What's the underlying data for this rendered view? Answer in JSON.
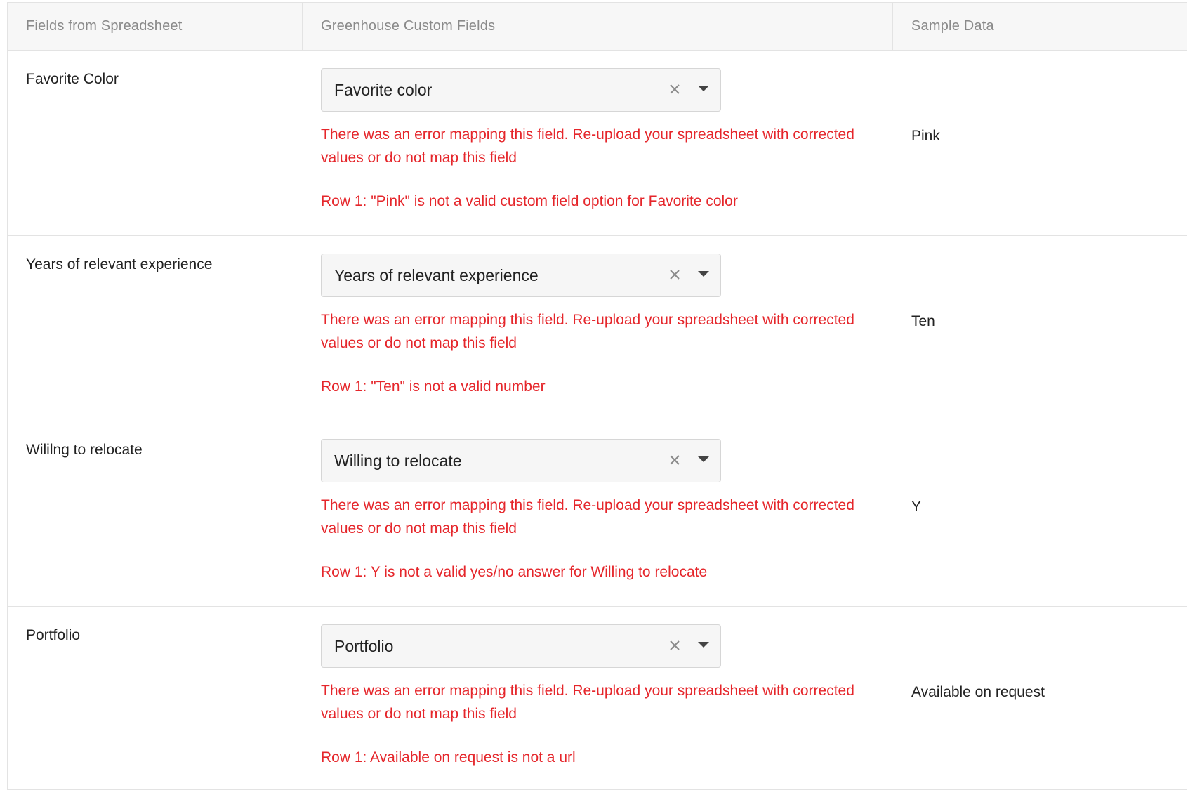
{
  "header": {
    "col_spreadsheet": "Fields from Spreadsheet",
    "col_custom": "Greenhouse Custom Fields",
    "col_sample": "Sample Data"
  },
  "rows": [
    {
      "spreadsheet_field": "Favorite Color",
      "selected_custom_field": "Favorite color",
      "error_main": "There was an error mapping this field. Re-upload your spreadsheet with corrected values or do not map this field",
      "error_detail": "Row 1: \"Pink\" is not a valid custom field option for Favorite color",
      "sample": "Pink"
    },
    {
      "spreadsheet_field": "Years of relevant experience",
      "selected_custom_field": "Years of relevant experience",
      "error_main": "There was an error mapping this field. Re-upload your spreadsheet with corrected values or do not map this field",
      "error_detail": "Row 1: \"Ten\" is not a valid number",
      "sample": "Ten"
    },
    {
      "spreadsheet_field": "Wililng to relocate",
      "selected_custom_field": "Willing to relocate",
      "error_main": "There was an error mapping this field. Re-upload your spreadsheet with corrected values or do not map this field",
      "error_detail": "Row 1: Y is not a valid yes/no answer for Willing to relocate",
      "sample": "Y"
    },
    {
      "spreadsheet_field": "Portfolio",
      "selected_custom_field": "Portfolio",
      "error_main": "There was an error mapping this field. Re-upload your spreadsheet with corrected values or do not map this field",
      "error_detail": "Row 1: Available on request is not a url",
      "sample": "Available on request"
    }
  ],
  "icons": {
    "clear": "close-icon",
    "dropdown": "chevron-down-icon"
  },
  "colors": {
    "error": "#e5262b",
    "header_bg": "#f7f7f7",
    "border": "#e3e3e3",
    "select_bg": "#f6f6f6"
  }
}
